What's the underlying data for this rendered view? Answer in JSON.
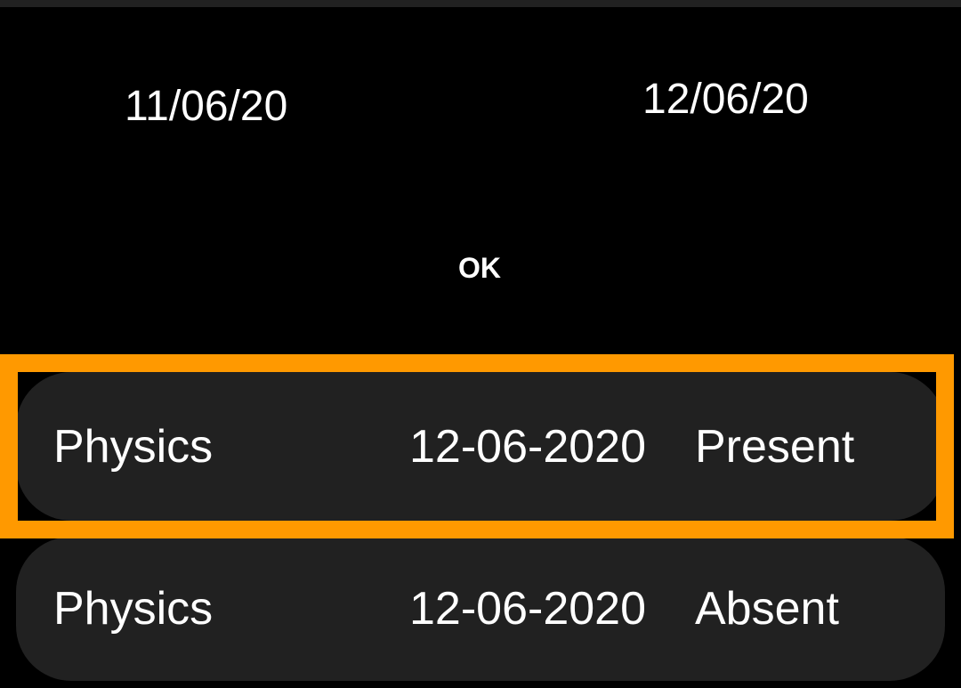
{
  "filter": {
    "from_date": "11/06/20",
    "to_date": "12/06/20",
    "ok_label": "OK"
  },
  "records": [
    {
      "subject": "Physics",
      "date": "12-06-2020",
      "status": "Present"
    },
    {
      "subject": "Physics",
      "date": "12-06-2020",
      "status": "Absent"
    }
  ],
  "highlight_color": "#ff9900"
}
